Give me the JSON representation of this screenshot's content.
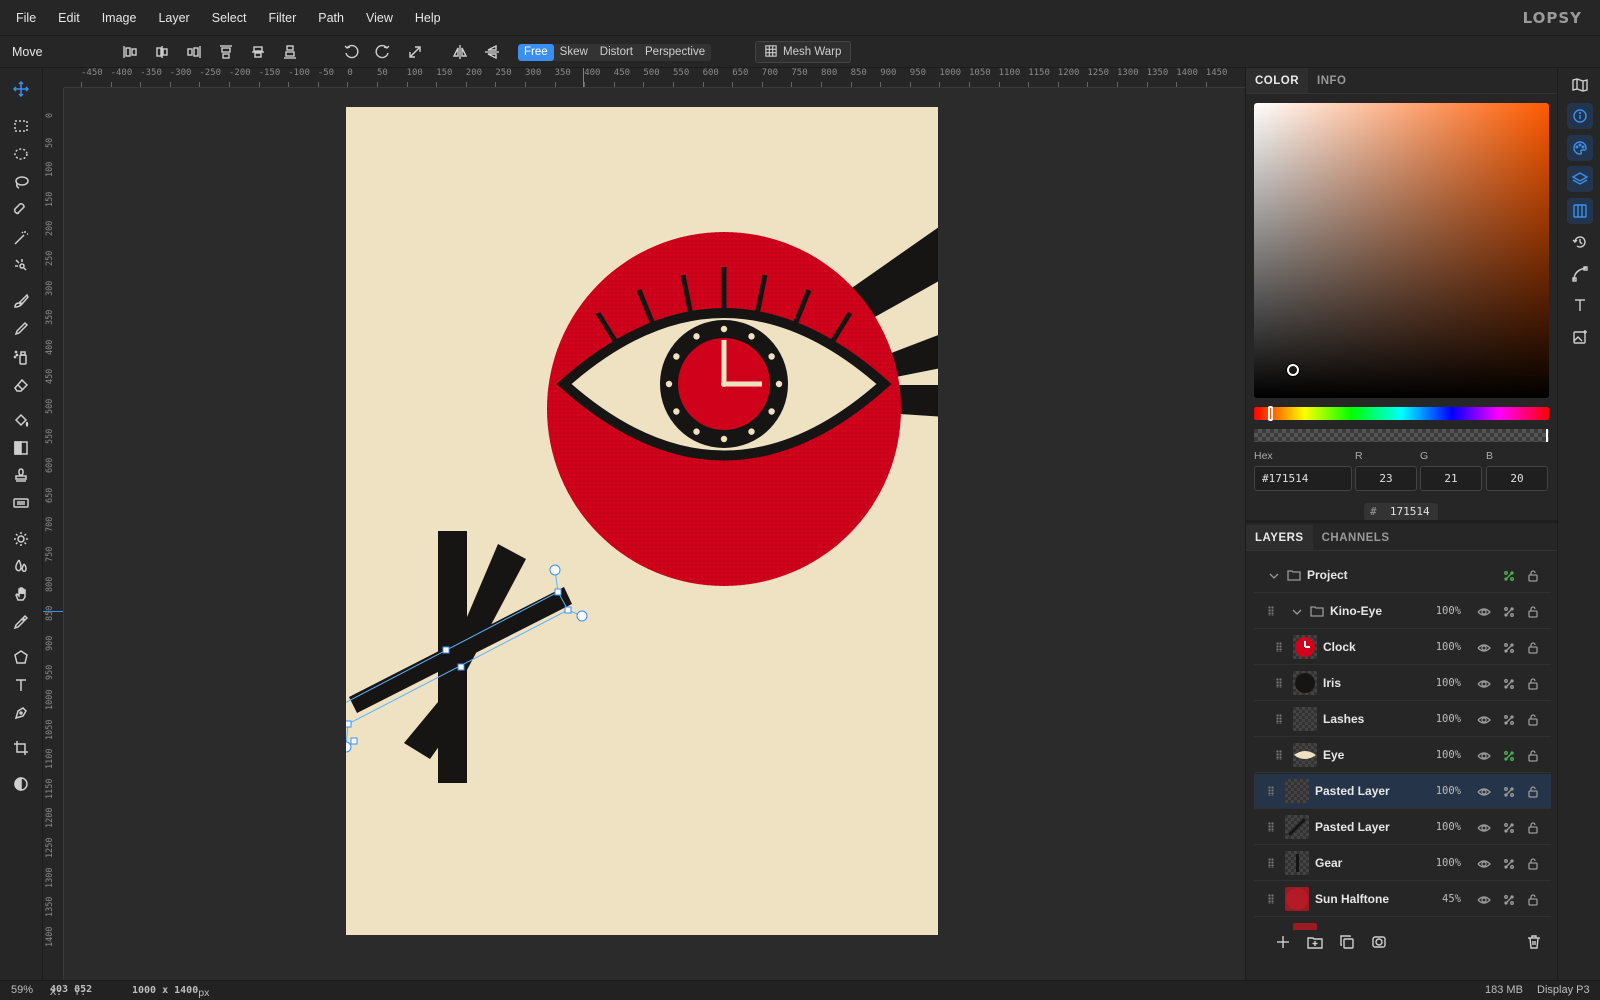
{
  "app": {
    "brand": "LOPSY"
  },
  "menu": [
    "File",
    "Edit",
    "Image",
    "Layer",
    "Select",
    "Filter",
    "Path",
    "View",
    "Help"
  ],
  "options": {
    "tool_label": "Move",
    "transform_modes": [
      "Free",
      "Skew",
      "Distort",
      "Perspective"
    ],
    "active_mode": "Free",
    "mesh_warp_label": "Mesh Warp"
  },
  "ruler": {
    "top_ticks": [
      "-450",
      "-400",
      "-350",
      "-300",
      "-250",
      "-200",
      "-150",
      "-100",
      "-50",
      "0",
      "50",
      "100",
      "150",
      "200",
      "250",
      "300",
      "350",
      "400",
      "450",
      "500",
      "550",
      "600",
      "650",
      "700",
      "750",
      "800",
      "850",
      "900",
      "950",
      "1000",
      "1050",
      "1100",
      "1150",
      "1200",
      "1250",
      "1300",
      "1350",
      "1400",
      "1450"
    ],
    "left_ticks": [
      "0",
      "50",
      "100",
      "150",
      "200",
      "250",
      "300",
      "350",
      "400",
      "450",
      "500",
      "550",
      "600",
      "650",
      "700",
      "750",
      "800",
      "850",
      "900",
      "950",
      "1000",
      "1050",
      "1100",
      "1150",
      "1200",
      "1250",
      "1300",
      "1350",
      "1400"
    ]
  },
  "color_panel": {
    "tabs": [
      "COLOR",
      "INFO"
    ],
    "active_tab": "COLOR",
    "hex_label": "Hex",
    "hex_value": "#171514",
    "r_label": "R",
    "r_value": "23",
    "g_label": "G",
    "g_value": "21",
    "b_label": "B",
    "b_value": "20",
    "hex_chip": "171514",
    "hex_chip_prefix": "#",
    "current_color": "#171514"
  },
  "layers_panel": {
    "tabs": [
      "LAYERS",
      "CHANNELS"
    ],
    "active_tab": "LAYERS",
    "rows": [
      {
        "name": "Project",
        "opacity": "",
        "kind": "group"
      },
      {
        "name": "Kino-Eye",
        "opacity": "100%",
        "kind": "group"
      },
      {
        "name": "Clock",
        "opacity": "100%",
        "kind": "layer"
      },
      {
        "name": "Iris",
        "opacity": "100%",
        "kind": "layer"
      },
      {
        "name": "Lashes",
        "opacity": "100%",
        "kind": "layer"
      },
      {
        "name": "Eye",
        "opacity": "100%",
        "kind": "layer"
      },
      {
        "name": "Pasted Layer",
        "opacity": "100%",
        "kind": "layer",
        "selected": true
      },
      {
        "name": "Pasted Layer",
        "opacity": "100%",
        "kind": "layer"
      },
      {
        "name": "Gear",
        "opacity": "100%",
        "kind": "layer"
      },
      {
        "name": "Sun Halftone",
        "opacity": "45%",
        "kind": "layer"
      }
    ]
  },
  "status": {
    "zoom": "59%",
    "x_label": "X:",
    "x": "403",
    "y_label": "Y:",
    "y": "852",
    "doc_size": "1000 x 1400",
    "doc_unit": "px",
    "memory": "183 MB",
    "color_profile": "Display P3"
  },
  "colors": {
    "accent": "#3b8ff0",
    "paper": "#efe2c3",
    "red": "#d0011b",
    "ink": "#171514"
  }
}
